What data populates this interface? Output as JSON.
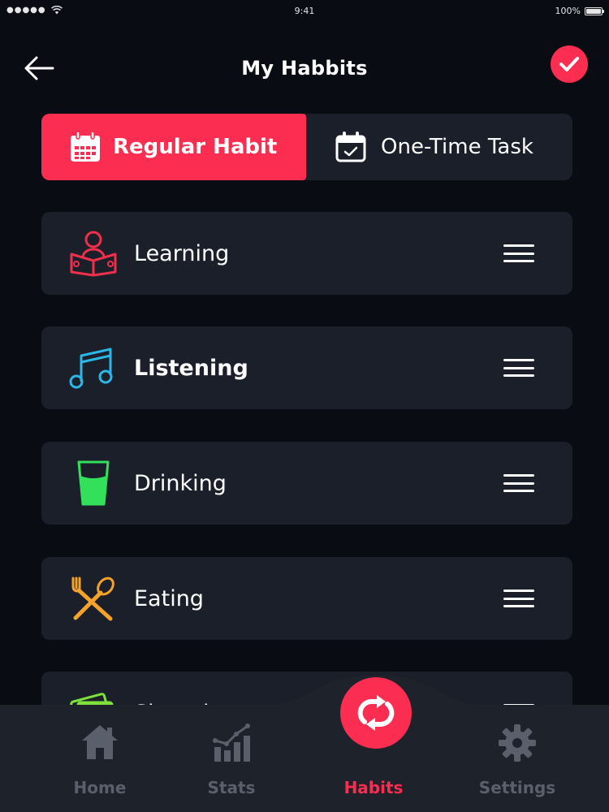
{
  "status_bar": {
    "signal": "●●●●●",
    "time": "9:41",
    "battery": "100%",
    "battery_level": 1.0
  },
  "header": {
    "title": "My Habbits",
    "back_icon": "arrow-left-icon",
    "done_icon": "check-icon"
  },
  "segmented": {
    "regular": {
      "label": "Regular Habit",
      "icon": "calendar-grid-icon",
      "selected": true
    },
    "onetime": {
      "label": "One-Time Task",
      "icon": "calendar-check-icon",
      "selected": false
    }
  },
  "habits": [
    {
      "label": "Learning",
      "icon": "reading-person-icon",
      "color": "#f0304a"
    },
    {
      "label": "Listening",
      "icon": "music-note-icon",
      "color": "#2bb7e8"
    },
    {
      "label": "Drinking",
      "icon": "water-glass-icon",
      "color": "#33e05a"
    },
    {
      "label": "Eating",
      "icon": "fork-spoon-icon",
      "color": "#f5a22a"
    },
    {
      "label": "Shopping",
      "icon": "money-icon",
      "color": "#7ee03a"
    }
  ],
  "tabs": [
    {
      "label": "Home",
      "icon": "home-icon",
      "active": false
    },
    {
      "label": "Stats",
      "icon": "stats-chart-icon",
      "active": false
    },
    {
      "label": "Habits",
      "icon": "repeat-icon",
      "active": true
    },
    {
      "label": "Settings",
      "icon": "gear-icon",
      "active": false
    }
  ],
  "colors": {
    "accent": "#fb2d50",
    "background": "#090c12",
    "card": "#1a1f29",
    "tab_bar": "#1d222b",
    "inactive_tab": "#5a606b"
  }
}
